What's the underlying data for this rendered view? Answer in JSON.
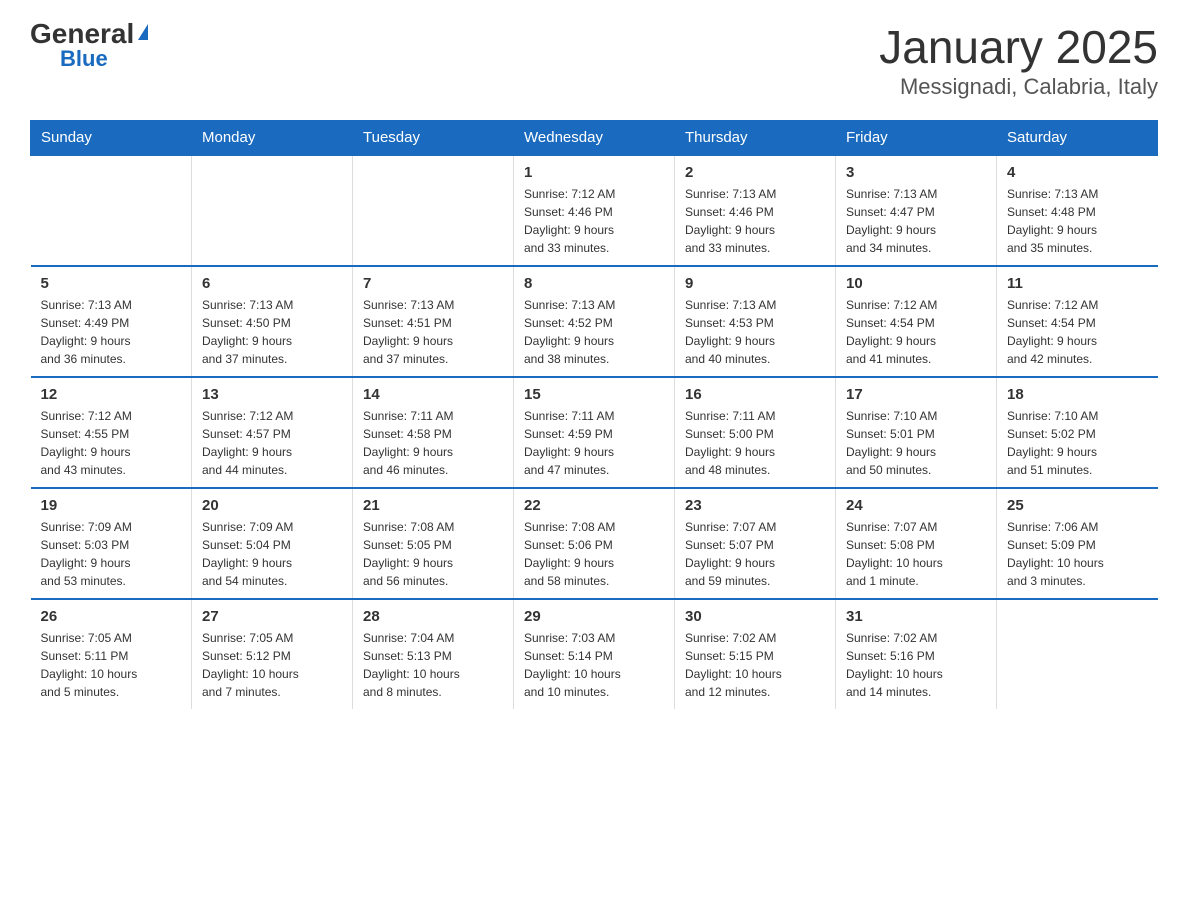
{
  "header": {
    "logo_general": "General",
    "logo_blue": "Blue",
    "month_title": "January 2025",
    "location": "Messignadi, Calabria, Italy"
  },
  "weekdays": [
    "Sunday",
    "Monday",
    "Tuesday",
    "Wednesday",
    "Thursday",
    "Friday",
    "Saturday"
  ],
  "weeks": [
    [
      {
        "day": "",
        "info": ""
      },
      {
        "day": "",
        "info": ""
      },
      {
        "day": "",
        "info": ""
      },
      {
        "day": "1",
        "info": "Sunrise: 7:12 AM\nSunset: 4:46 PM\nDaylight: 9 hours\nand 33 minutes."
      },
      {
        "day": "2",
        "info": "Sunrise: 7:13 AM\nSunset: 4:46 PM\nDaylight: 9 hours\nand 33 minutes."
      },
      {
        "day": "3",
        "info": "Sunrise: 7:13 AM\nSunset: 4:47 PM\nDaylight: 9 hours\nand 34 minutes."
      },
      {
        "day": "4",
        "info": "Sunrise: 7:13 AM\nSunset: 4:48 PM\nDaylight: 9 hours\nand 35 minutes."
      }
    ],
    [
      {
        "day": "5",
        "info": "Sunrise: 7:13 AM\nSunset: 4:49 PM\nDaylight: 9 hours\nand 36 minutes."
      },
      {
        "day": "6",
        "info": "Sunrise: 7:13 AM\nSunset: 4:50 PM\nDaylight: 9 hours\nand 37 minutes."
      },
      {
        "day": "7",
        "info": "Sunrise: 7:13 AM\nSunset: 4:51 PM\nDaylight: 9 hours\nand 37 minutes."
      },
      {
        "day": "8",
        "info": "Sunrise: 7:13 AM\nSunset: 4:52 PM\nDaylight: 9 hours\nand 38 minutes."
      },
      {
        "day": "9",
        "info": "Sunrise: 7:13 AM\nSunset: 4:53 PM\nDaylight: 9 hours\nand 40 minutes."
      },
      {
        "day": "10",
        "info": "Sunrise: 7:12 AM\nSunset: 4:54 PM\nDaylight: 9 hours\nand 41 minutes."
      },
      {
        "day": "11",
        "info": "Sunrise: 7:12 AM\nSunset: 4:54 PM\nDaylight: 9 hours\nand 42 minutes."
      }
    ],
    [
      {
        "day": "12",
        "info": "Sunrise: 7:12 AM\nSunset: 4:55 PM\nDaylight: 9 hours\nand 43 minutes."
      },
      {
        "day": "13",
        "info": "Sunrise: 7:12 AM\nSunset: 4:57 PM\nDaylight: 9 hours\nand 44 minutes."
      },
      {
        "day": "14",
        "info": "Sunrise: 7:11 AM\nSunset: 4:58 PM\nDaylight: 9 hours\nand 46 minutes."
      },
      {
        "day": "15",
        "info": "Sunrise: 7:11 AM\nSunset: 4:59 PM\nDaylight: 9 hours\nand 47 minutes."
      },
      {
        "day": "16",
        "info": "Sunrise: 7:11 AM\nSunset: 5:00 PM\nDaylight: 9 hours\nand 48 minutes."
      },
      {
        "day": "17",
        "info": "Sunrise: 7:10 AM\nSunset: 5:01 PM\nDaylight: 9 hours\nand 50 minutes."
      },
      {
        "day": "18",
        "info": "Sunrise: 7:10 AM\nSunset: 5:02 PM\nDaylight: 9 hours\nand 51 minutes."
      }
    ],
    [
      {
        "day": "19",
        "info": "Sunrise: 7:09 AM\nSunset: 5:03 PM\nDaylight: 9 hours\nand 53 minutes."
      },
      {
        "day": "20",
        "info": "Sunrise: 7:09 AM\nSunset: 5:04 PM\nDaylight: 9 hours\nand 54 minutes."
      },
      {
        "day": "21",
        "info": "Sunrise: 7:08 AM\nSunset: 5:05 PM\nDaylight: 9 hours\nand 56 minutes."
      },
      {
        "day": "22",
        "info": "Sunrise: 7:08 AM\nSunset: 5:06 PM\nDaylight: 9 hours\nand 58 minutes."
      },
      {
        "day": "23",
        "info": "Sunrise: 7:07 AM\nSunset: 5:07 PM\nDaylight: 9 hours\nand 59 minutes."
      },
      {
        "day": "24",
        "info": "Sunrise: 7:07 AM\nSunset: 5:08 PM\nDaylight: 10 hours\nand 1 minute."
      },
      {
        "day": "25",
        "info": "Sunrise: 7:06 AM\nSunset: 5:09 PM\nDaylight: 10 hours\nand 3 minutes."
      }
    ],
    [
      {
        "day": "26",
        "info": "Sunrise: 7:05 AM\nSunset: 5:11 PM\nDaylight: 10 hours\nand 5 minutes."
      },
      {
        "day": "27",
        "info": "Sunrise: 7:05 AM\nSunset: 5:12 PM\nDaylight: 10 hours\nand 7 minutes."
      },
      {
        "day": "28",
        "info": "Sunrise: 7:04 AM\nSunset: 5:13 PM\nDaylight: 10 hours\nand 8 minutes."
      },
      {
        "day": "29",
        "info": "Sunrise: 7:03 AM\nSunset: 5:14 PM\nDaylight: 10 hours\nand 10 minutes."
      },
      {
        "day": "30",
        "info": "Sunrise: 7:02 AM\nSunset: 5:15 PM\nDaylight: 10 hours\nand 12 minutes."
      },
      {
        "day": "31",
        "info": "Sunrise: 7:02 AM\nSunset: 5:16 PM\nDaylight: 10 hours\nand 14 minutes."
      },
      {
        "day": "",
        "info": ""
      }
    ]
  ]
}
